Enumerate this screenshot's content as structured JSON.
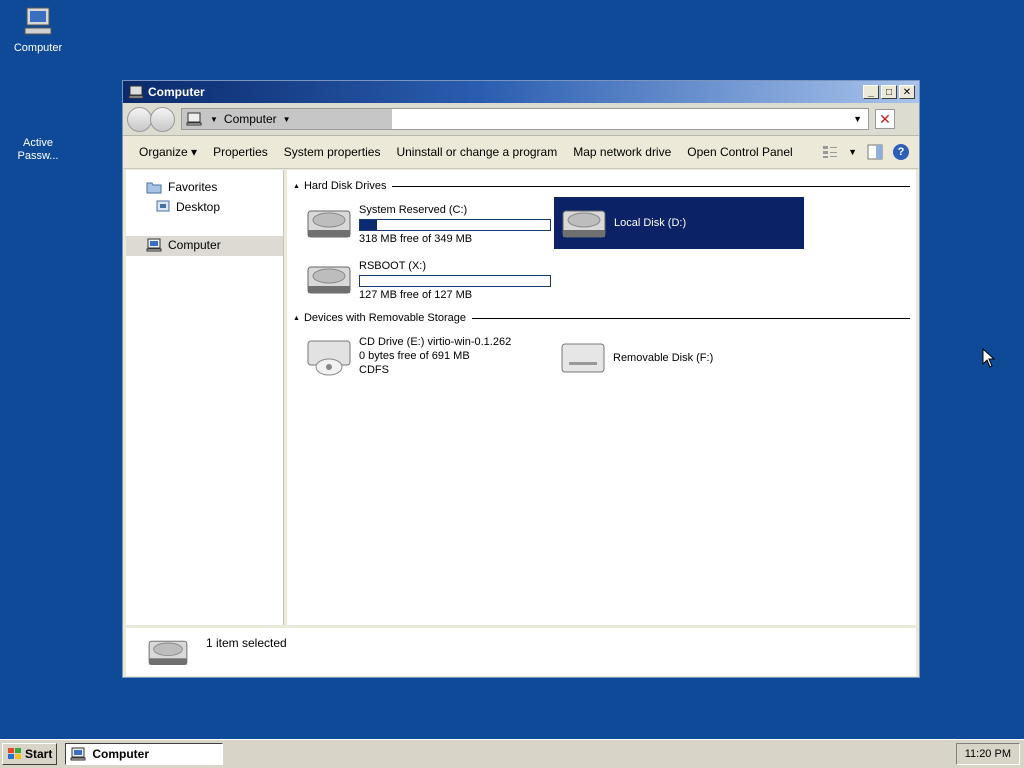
{
  "desktop": {
    "icons": [
      {
        "label": "Computer"
      },
      {
        "label": "Active\nPassw..."
      }
    ]
  },
  "window": {
    "title": "Computer",
    "address": {
      "crumb": "Computer"
    },
    "toolbar": {
      "items": [
        "Organize",
        "Properties",
        "System properties",
        "Uninstall or change a program",
        "Map network drive",
        "Open Control Panel"
      ]
    },
    "nav": {
      "favorites": "Favorites",
      "desktop": "Desktop",
      "computer": "Computer"
    },
    "groups": {
      "hard_disks": "Hard Disk Drives",
      "removable": "Devices with Removable Storage"
    },
    "drives": {
      "c": {
        "name": "System Reserved (C:)",
        "free": "318 MB free of 349 MB",
        "used_fraction": 0.09
      },
      "d": {
        "name": "Local Disk (D:)"
      },
      "x": {
        "name": "RSBOOT (X:)",
        "free": "127 MB free of 127 MB",
        "used_fraction": 0.0
      },
      "e": {
        "name": "CD Drive (E:) virtio-win-0.1.262",
        "free": "0 bytes free of 691 MB",
        "fs": "CDFS"
      },
      "f": {
        "name": "Removable Disk (F:)"
      }
    },
    "details": {
      "status": "1 item selected"
    }
  },
  "taskbar": {
    "start": "Start",
    "task": "Computer",
    "clock": "11:20 PM"
  },
  "colors": {
    "desktop": "#0e4a98",
    "selection": "#0b2266",
    "bar_fill": "#0c2a72"
  }
}
